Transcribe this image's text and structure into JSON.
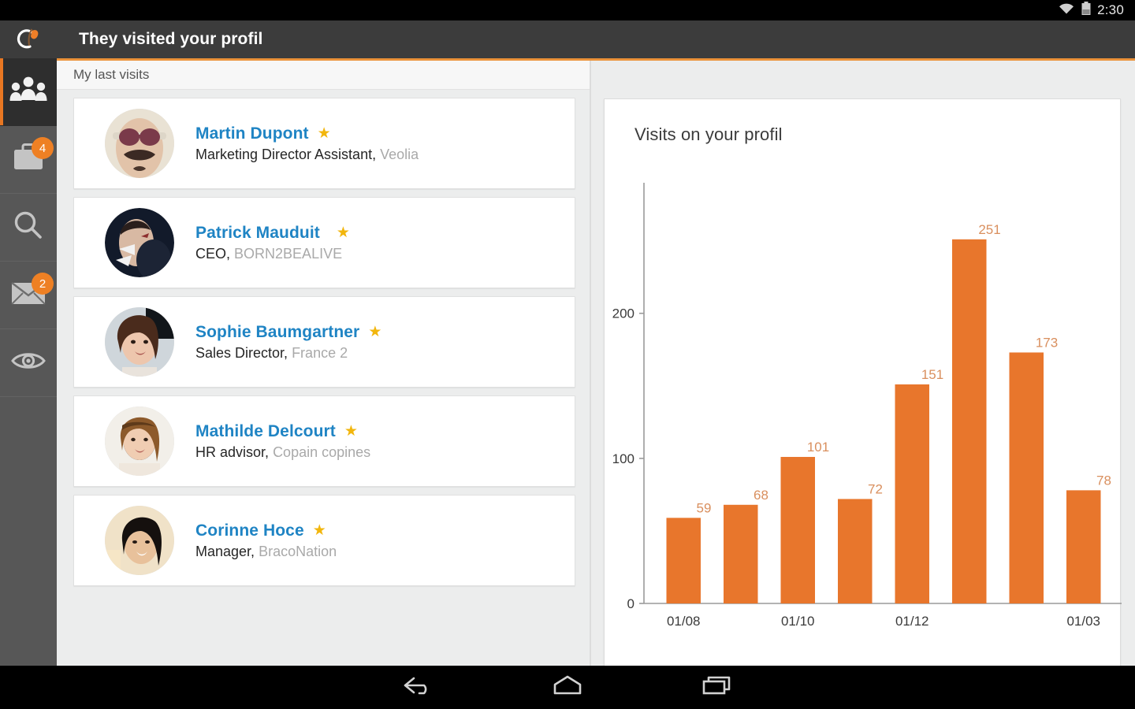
{
  "status_bar": {
    "clock": "2:30",
    "wifi_icon": "wifi-icon",
    "battery_icon": "battery-icon"
  },
  "header": {
    "title": "They visited your profil",
    "accent_color": "#eb9239",
    "background_color": "#3c3c3c"
  },
  "sidebar": {
    "logo_icon": "leaf-circle-logo-icon",
    "items": [
      {
        "name": "visitors",
        "icon": "people-group-icon",
        "badge": "",
        "active": true
      },
      {
        "name": "jobs",
        "icon": "briefcase-icon",
        "badge": "4",
        "active": false
      },
      {
        "name": "search",
        "icon": "search-icon",
        "badge": "",
        "active": false
      },
      {
        "name": "messages",
        "icon": "envelope-icon",
        "badge": "2",
        "active": false
      },
      {
        "name": "views",
        "icon": "eye-icon",
        "badge": "",
        "active": false
      }
    ],
    "badge_color": "#ee8024"
  },
  "left_panel": {
    "section_label": "My last visits",
    "visitors": [
      {
        "name": "Martin Dupont",
        "starred": true,
        "star": "★",
        "role": "Marketing Director Assistant,",
        "company": "Veolia"
      },
      {
        "name": "Patrick Mauduit",
        "starred": true,
        "star": "★",
        "role": "CEO,",
        "company": "BORN2BEALIVE"
      },
      {
        "name": "Sophie Baumgartner",
        "starred": true,
        "star": "★",
        "role": "Sales Director,",
        "company": "France 2"
      },
      {
        "name": "Mathilde Delcourt",
        "starred": true,
        "star": "★",
        "role": "HR advisor,",
        "company": "Copain copines"
      },
      {
        "name": "Corinne Hoce",
        "starred": true,
        "star": "★",
        "role": "Manager,",
        "company": "BracoNation"
      }
    ],
    "name_color": "#1f84c4",
    "star_color": "#f2b60d",
    "company_color": "#a9a9a9"
  },
  "right_panel": {
    "chart_title": "Visits on your profil"
  },
  "nav_bar": {
    "back_icon": "back-arrow-icon",
    "home_icon": "home-icon",
    "recents_icon": "recent-apps-icon"
  },
  "chart_data": {
    "type": "bar",
    "title": "Visits on your profil",
    "xlabel": "",
    "ylabel": "",
    "categories": [
      "01/08",
      "",
      "01/10",
      "",
      "01/12",
      "",
      "",
      "01/03"
    ],
    "values": [
      59,
      68,
      101,
      72,
      151,
      251,
      173,
      78
    ],
    "data_labels": [
      "59",
      "68",
      "101",
      "72",
      "151",
      "251",
      "173",
      "78"
    ],
    "xtick_labels": [
      "01/08",
      "01/10",
      "01/12",
      "01/03"
    ],
    "xtick_indices": [
      0,
      2,
      4,
      7
    ],
    "ytick_labels": [
      "0",
      "100",
      "200"
    ],
    "ytick_values": [
      0,
      100,
      200
    ],
    "ylim": [
      0,
      290
    ],
    "grid": false,
    "legend": "none",
    "bar_color": "#e8762c",
    "label_color": "#d98f5e",
    "axis_color": "#9a9a9a"
  }
}
